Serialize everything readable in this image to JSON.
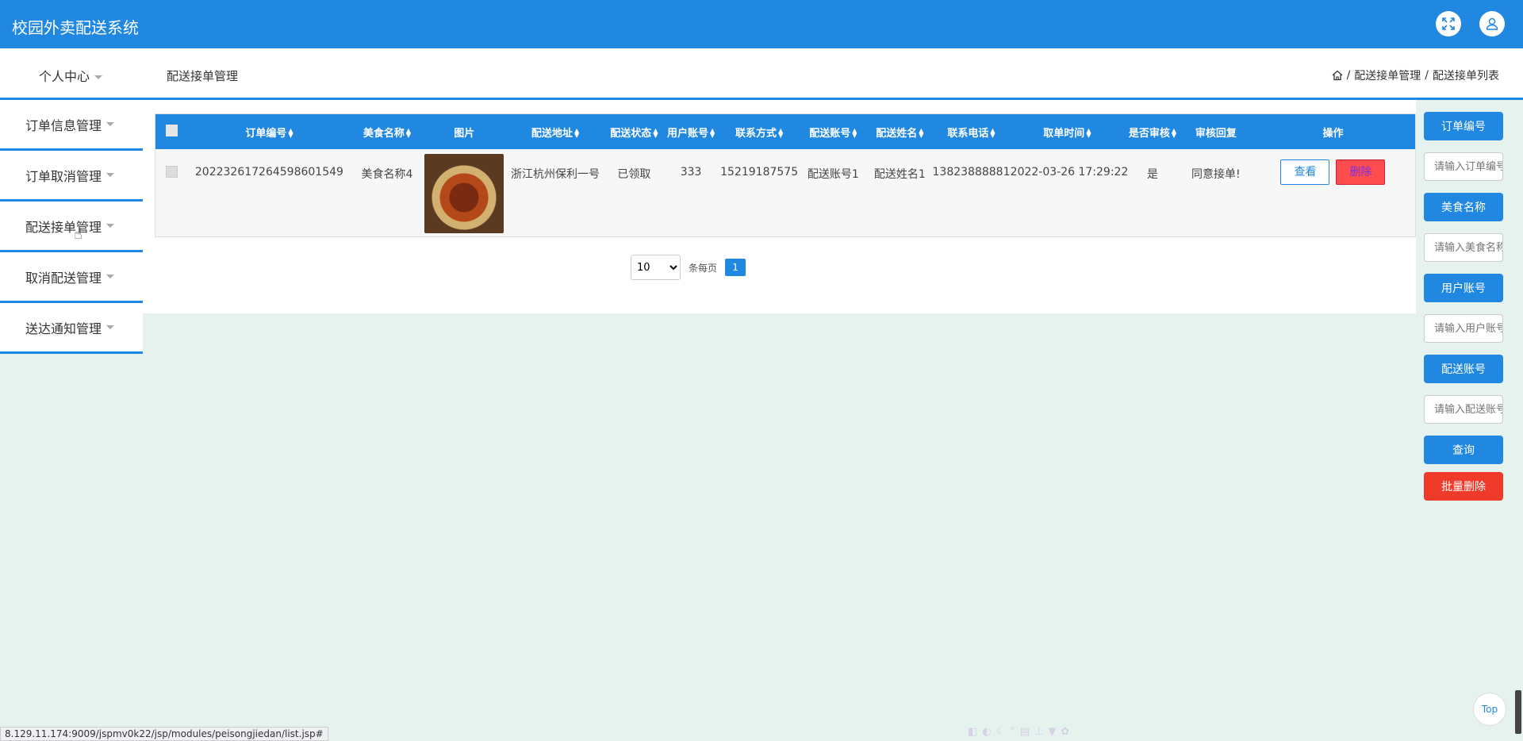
{
  "app": {
    "title": "校园外卖配送系统"
  },
  "header": {
    "personal_center": "个人中心",
    "page_heading": "配送接单管理"
  },
  "breadcrumb": {
    "items": [
      "配送接单管理",
      "配送接单列表"
    ],
    "separator": "/"
  },
  "sidebar": {
    "items": [
      {
        "label": "订单信息管理"
      },
      {
        "label": "订单取消管理"
      },
      {
        "label": "配送接单管理"
      },
      {
        "label": "取消配送管理"
      },
      {
        "label": "送达通知管理"
      }
    ]
  },
  "table": {
    "headers": [
      "订单编号",
      "美食名称",
      "图片",
      "配送地址",
      "配送状态",
      "用户账号",
      "联系方式",
      "配送账号",
      "配送姓名",
      "联系电话",
      "取单时间",
      "是否审核",
      "审核回复",
      "操作"
    ],
    "rows": [
      {
        "order_no": "202232617264598601549",
        "food_name": "美食名称4",
        "address": "浙江杭州保利一号",
        "status": "已领取",
        "user_account": "333",
        "contact": "15219187575",
        "courier_account": "配送账号1",
        "courier_name": "配送姓名1",
        "phone": "13823888881",
        "pickup_time": "2022-03-26 17:29:22",
        "reviewed": "是",
        "review_reply": "同意接单!",
        "view_label": "查看",
        "delete_label": "删除"
      }
    ]
  },
  "pagination": {
    "page_size": "10",
    "per_page_label": "条每页",
    "current_page": "1"
  },
  "search": {
    "fields": [
      {
        "label": "订单编号",
        "placeholder": "请输入订单编号"
      },
      {
        "label": "美食名称",
        "placeholder": "请输入美食名称"
      },
      {
        "label": "用户账号",
        "placeholder": "请输入用户账号"
      },
      {
        "label": "配送账号",
        "placeholder": "请输入配送账号"
      }
    ],
    "query_label": "查询",
    "batch_delete_label": "批量删除"
  },
  "top_button": "Top",
  "status_url": "8.129.11.174:9009/jspmv0k22/jsp/modules/peisongjiedan/list.jsp#",
  "colors": {
    "primary": "#2088e0",
    "danger": "#f03a2a",
    "background": "#e6f2ee"
  }
}
